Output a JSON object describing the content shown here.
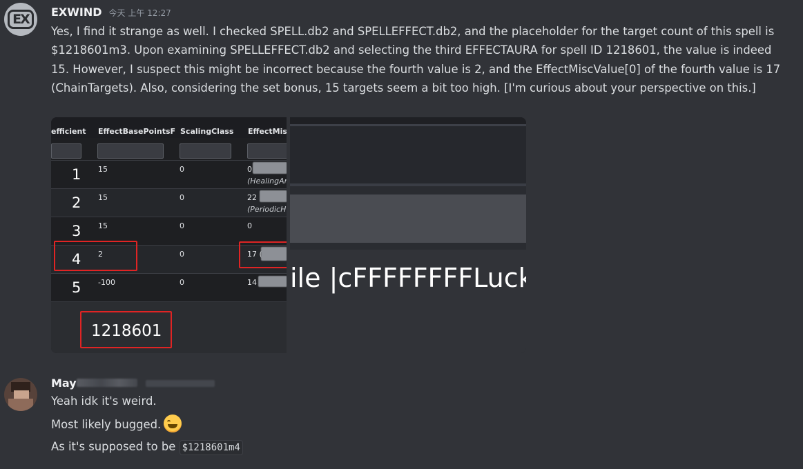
{
  "message1": {
    "username": "EXWIND",
    "timestamp": "今天 上午 12:27",
    "avatar_icon": "ex-logo-icon",
    "avatar_text": "EX",
    "text": "Yes, I find it strange as well. I checked SPELL.db2 and SPELLEFFECT.db2, and the placeholder for the target count of this spell is $1218601m3. Upon examining SPELLEFFECT.db2 and selecting the third EFFECTAURA for spell ID 1218601, the value is indeed 15. However, I suspect this might be incorrect because the fourth value is 2, and the EffectMiscValue[0] of the fourth value is 17 (ChainTargets). Also, considering the set bonus, 15 targets seem a bit too high. [I'm curious about your perspective on this.]",
    "attachment": {
      "table": {
        "headers": [
          "efficient",
          "EffectBasePointsF",
          "ScalingClass",
          "EffectMisc"
        ],
        "rows": [
          {
            "num": "1",
            "base": "15",
            "scaling": "0",
            "misc": "0",
            "sub": "(HealingAr"
          },
          {
            "num": "2",
            "base": "15",
            "scaling": "0",
            "misc": "22",
            "sub": "(PeriodicH"
          },
          {
            "num": "3",
            "base": "15",
            "scaling": "0",
            "misc": "0",
            "sub": ""
          },
          {
            "num": "4",
            "base": "2",
            "scaling": "0",
            "misc": "17 (",
            "sub": ""
          },
          {
            "num": "5",
            "base": "-100",
            "scaling": "0",
            "misc": "14",
            "sub": ""
          }
        ],
        "spell_id": "1218601"
      },
      "right_text": "ile |cFFFFFFFFLuck o"
    }
  },
  "message2": {
    "username": "May",
    "lines": [
      {
        "text": "Yeah idk it's weird."
      },
      {
        "text": "Most likely bugged.",
        "emoji": "grinning-face-emoji"
      },
      {
        "text": "As it's supposed to be",
        "code": "$1218601m4"
      }
    ]
  },
  "colors": {
    "background": "#313338",
    "highlight_red": "#e02424"
  }
}
